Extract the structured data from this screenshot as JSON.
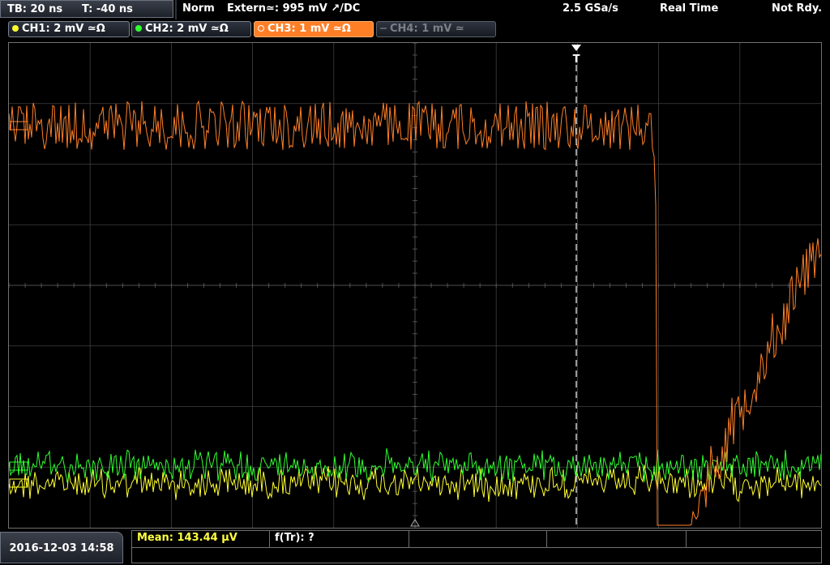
{
  "timebase": {
    "tb": "TB: 20 ns",
    "trigger_offset": "T: -40 ns"
  },
  "status": {
    "mode": "Norm",
    "trigger_source": "Extern≃: 995 mV ↗/DC",
    "sample_rate": "2.5 GSa/s",
    "acq": "Real Time",
    "ready": "Not Rdy."
  },
  "channels": [
    {
      "label": "CH1: 2 mV ≃Ω",
      "color": "#ffff30",
      "state": "on"
    },
    {
      "label": "CH2: 2 mV ≃Ω",
      "color": "#30ff30",
      "state": "on"
    },
    {
      "label": "CH3: 1 mV ≃Ω",
      "color": "#ff7f27",
      "state": "active"
    },
    {
      "label": "CH4: 1 mV ≃",
      "color": "#6a6f78",
      "state": "off"
    }
  ],
  "markers": {
    "trigger": "T"
  },
  "bottom": {
    "datetime": "2016-12-03 14:58",
    "mean": "Mean: 143.44 µV",
    "ftr": "f(Tr): ?"
  },
  "colors": {
    "ch1": "#ffff30",
    "ch2": "#30ff30",
    "ch3": "#ff7f27",
    "grid": "#404040"
  }
}
